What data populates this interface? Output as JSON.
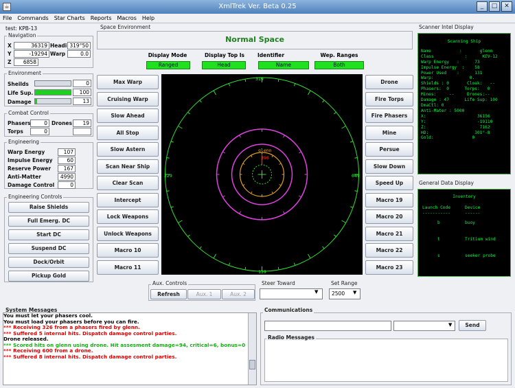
{
  "window": {
    "title": "XmlTrek Ver. Beta 0.25",
    "icon": "java-cup",
    "min": "_",
    "max": "□",
    "close": "✕"
  },
  "menu": [
    "File",
    "Commands",
    "Star Charts",
    "Reports",
    "Macros",
    "Help"
  ],
  "ship": "test: KPB-13",
  "nav": {
    "title": "Navigation",
    "x": "36319",
    "heading_label": "Heading",
    "heading": "319°50",
    "y": "-19294",
    "warp_label": "Warp",
    "warp": "0.0",
    "z": "6858"
  },
  "env": {
    "title": "Environment",
    "shields_label": "Sheilds",
    "shields": "0",
    "shields_fill": 0,
    "lifesup_label": "Life Sup.",
    "lifesup": "100",
    "lifesup_fill": 1.0,
    "damage_label": "Damage",
    "damage": "13",
    "damage_fill": 0.05
  },
  "combat": {
    "title": "Combat Control",
    "phasers_label": "Phasers",
    "phasers": "0",
    "drones_label": "Drones",
    "drones": "19",
    "torps_label": "Torps",
    "torps": "0",
    "extra": ""
  },
  "eng": {
    "title": "Engineering",
    "rows": [
      {
        "label": "Warp Energy",
        "value": "107"
      },
      {
        "label": "Impulse Energy",
        "value": "60"
      },
      {
        "label": "Reserve Power",
        "value": "167"
      },
      {
        "label": "Anti-Matter",
        "value": "4990"
      },
      {
        "label": "Damage Control",
        "value": "0"
      }
    ]
  },
  "engctl": {
    "title": "Engineering Controls",
    "buttons": [
      "Raise Shields",
      "Full Emerg. DC",
      "Start DC",
      "Suspend DC",
      "Dock/Orbit",
      "Pickup Gold"
    ]
  },
  "space": {
    "title": "Space Environment",
    "status": "Normal Space",
    "headers": [
      "Display Mode",
      "Display Top Is",
      "Identifier",
      "Wep. Ranges"
    ],
    "values": [
      "Ranged",
      "Head",
      "Name",
      "Both"
    ]
  },
  "left_buttons": [
    "Max Warp",
    "Cruising Warp",
    "Slow Ahead",
    "All Stop",
    "Slow Astern",
    "Scan Near Ship",
    "Clear Scan",
    "Intercept",
    "Lock Weapons",
    "Unlock Weapons",
    "Macro 10",
    "Macro 11"
  ],
  "right_buttons": [
    "Drone",
    "Fire Torps",
    "Fire Phasers",
    "Mine",
    "Persue",
    "Slow Down",
    "Speed Up",
    "Macro 19",
    "Macro 20",
    "Macro 21",
    "Macro 22",
    "Macro 23"
  ],
  "radar": {
    "top": "319",
    "bottom": "139",
    "left": "229",
    "right": "049",
    "target_name": "glenn",
    "target_range": "390",
    "colors": {
      "outer": "#30e030",
      "mid": "#e040e0",
      "inner": "#e0a020",
      "target": "#ff2020"
    }
  },
  "aux": {
    "title": "Aux. Controls",
    "buttons": [
      "Refresh",
      "Aux. 1",
      "Aux. 2"
    ],
    "steer_label": "Steer Toward",
    "steer_value": "",
    "range_label": "Set Range",
    "range_value": "2500"
  },
  "scanner": {
    "title": "Scanner Intel Display",
    "heading": "Scanning Ship",
    "lines": [
      "Name           :       glenn",
      "Class            :      KEV-12",
      "Warp Energy   :      73",
      "Impulse Energy  :    58",
      "Power Used    :      131",
      "Warp:              0.",
      "Shields : 0       Cloak:   --",
      "Phasers:  0      Torps:   0",
      "Mines:     --     Drones:--",
      "Damage : 47      Life Sup: 100",
      "DmaCtl: 0",
      "Anti-Mater : 5000",
      "X:                    36156",
      "Y:                    -19110",
      "Z:                     7162",
      "HD:                  301°-8",
      "Gold:               0"
    ]
  },
  "general": {
    "title": "General Data Display",
    "heading": "Inventory",
    "col1": "Launch Code",
    "col2": "Device",
    "sep1": "-----------",
    "sep2": "------",
    "items": [
      {
        "code": "b",
        "device": "buoy"
      },
      {
        "code": "t",
        "device": "Tritium wind"
      },
      {
        "code": "s",
        "device": "seeker probe"
      }
    ]
  },
  "messages": {
    "title": "System Messages",
    "lines": [
      {
        "text": "You must let your phasers cool.",
        "color": "#000000"
      },
      {
        "text": "You must load your phasers before you can fire.",
        "color": "#000000"
      },
      {
        "text": "*** Receiving 326 from a phasers fired by glenn.",
        "color": "#e00000"
      },
      {
        "text": "*** Suffered 5 internal hits. Dispatch damage control parties.",
        "color": "#e00000"
      },
      {
        "text": "Drone released.",
        "color": "#000000"
      },
      {
        "text": "*** Scored hits on glenn using drone. Hit assesment damage=94, critical=6, bonus=0",
        "color": "#10b010"
      },
      {
        "text": "*** Receiving 600 from a drone.",
        "color": "#e00000"
      },
      {
        "text": "*** Suffered 8 internal hits. Dispatch damage control parties.",
        "color": "#e00000"
      }
    ]
  },
  "comm": {
    "title": "Communications",
    "input": "",
    "select": "",
    "send": "Send",
    "radio_title": "Radio Messages"
  }
}
